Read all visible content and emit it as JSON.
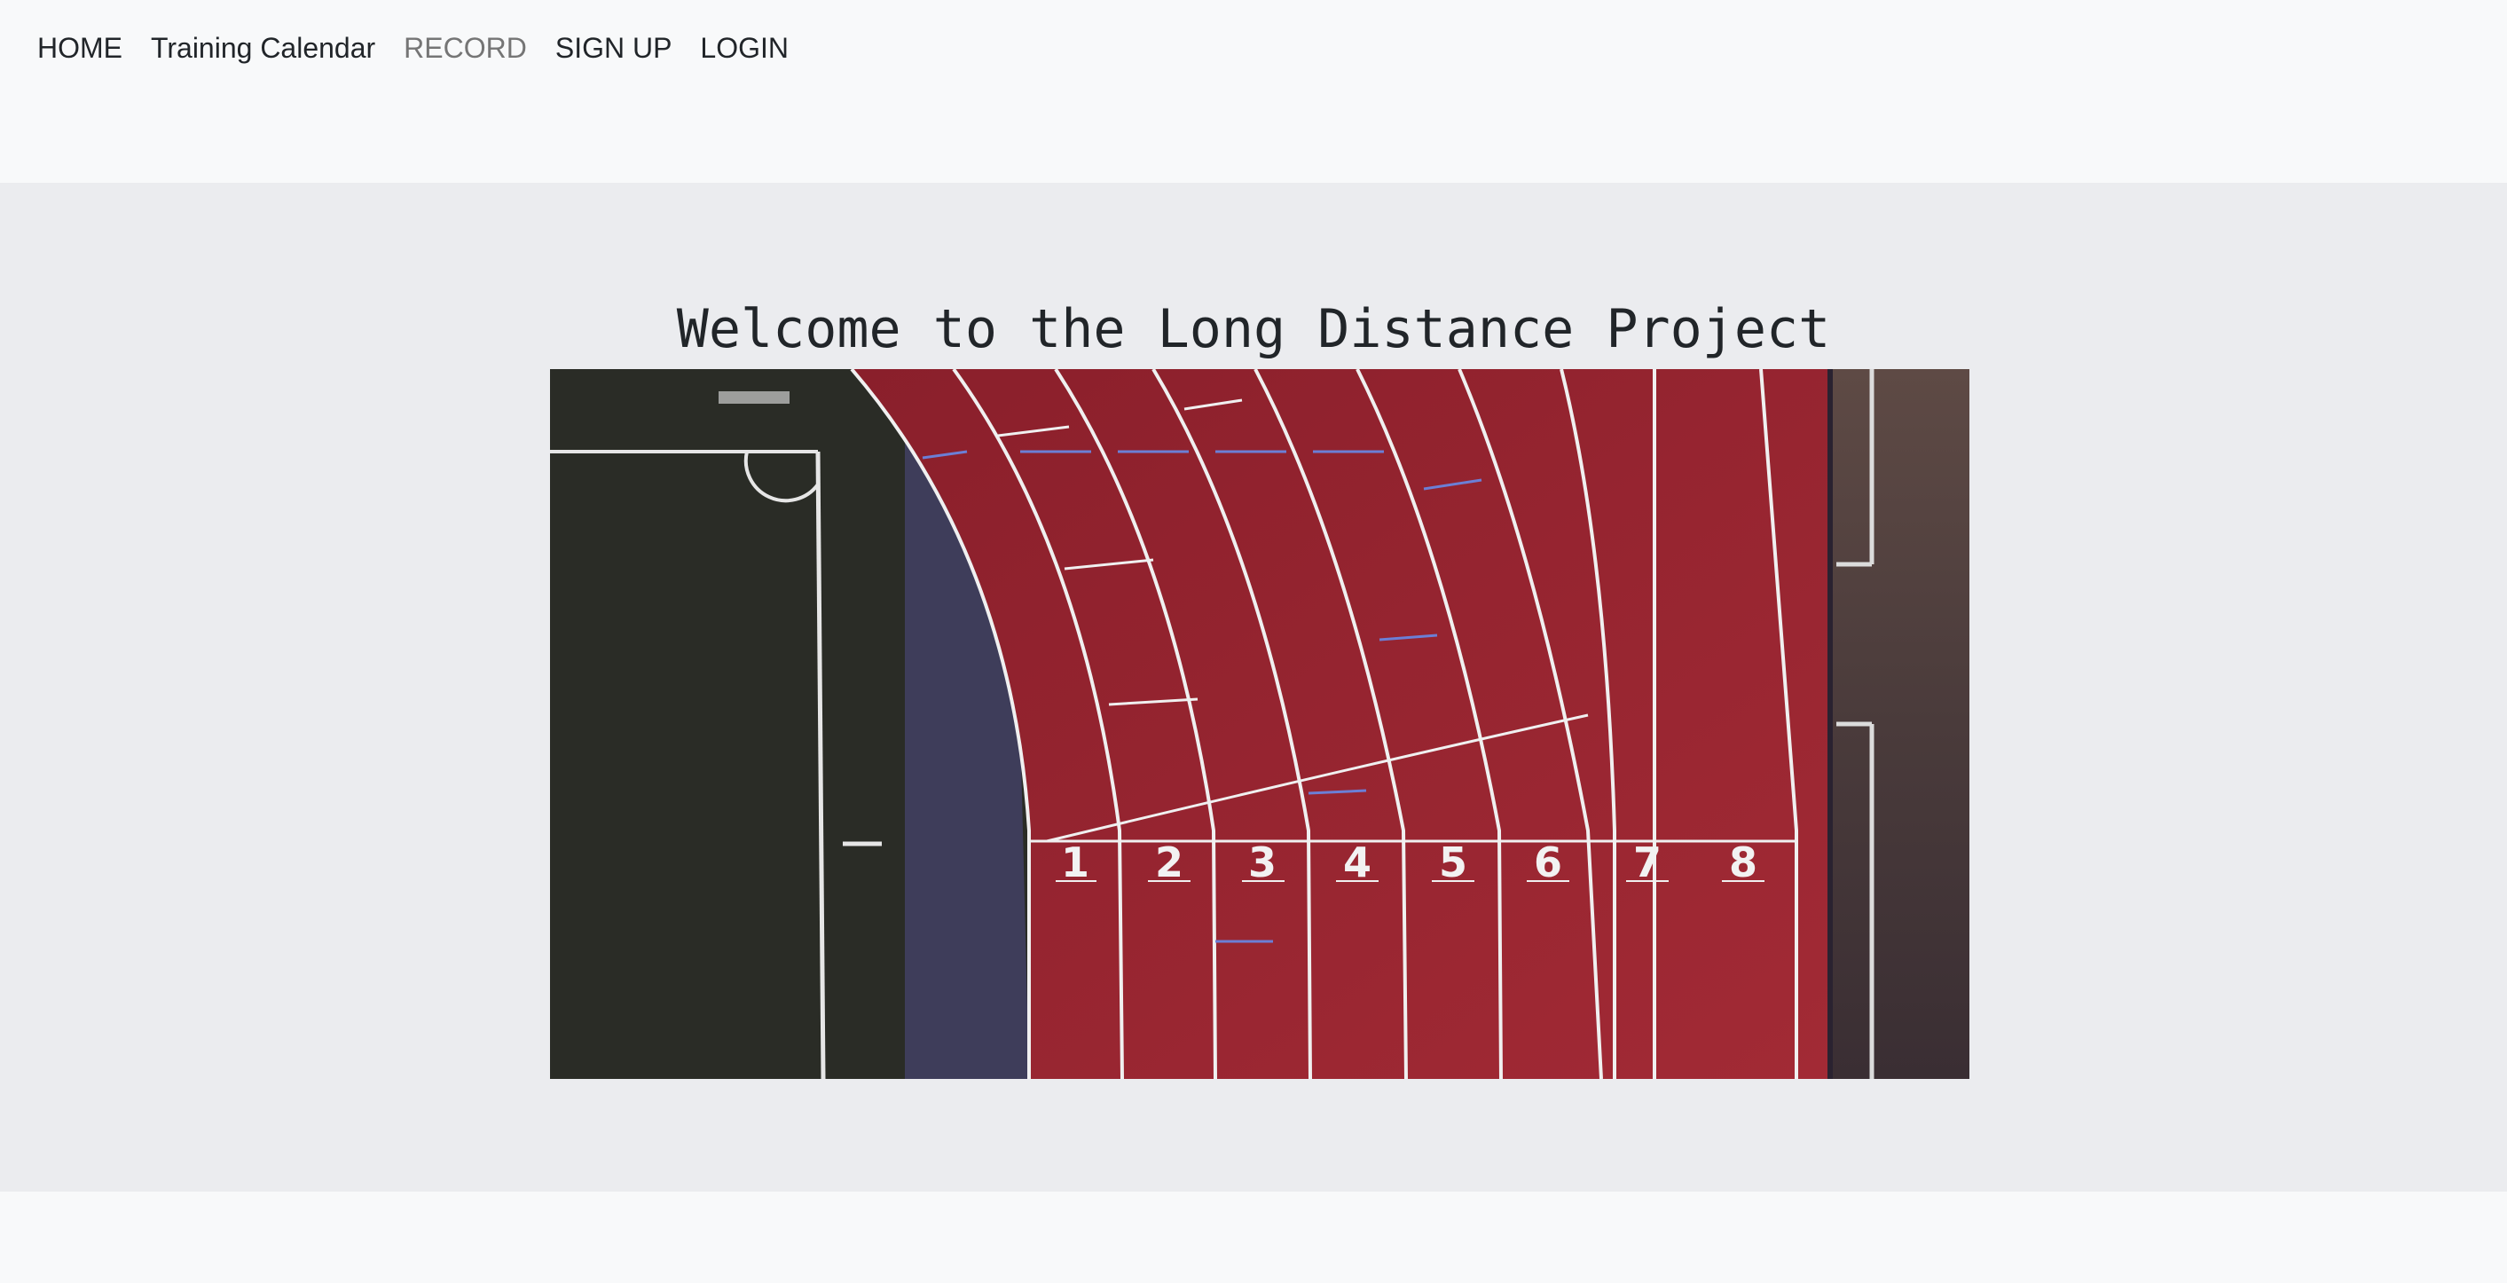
{
  "nav": {
    "items": [
      {
        "label": "HOME"
      },
      {
        "label": "Training Calendar"
      },
      {
        "label": "RECORD"
      },
      {
        "label": "SIGN UP"
      },
      {
        "label": "LOGIN"
      }
    ]
  },
  "hero": {
    "title": "Welcome to the Long Distance Project",
    "image": {
      "lane_numbers": [
        "1",
        "2",
        "3",
        "4",
        "5",
        "6",
        "7",
        "8"
      ],
      "colors": {
        "track": "#9b2430",
        "field": "#2a2c26",
        "infield_tiles": "#3e3d5a"
      }
    }
  }
}
